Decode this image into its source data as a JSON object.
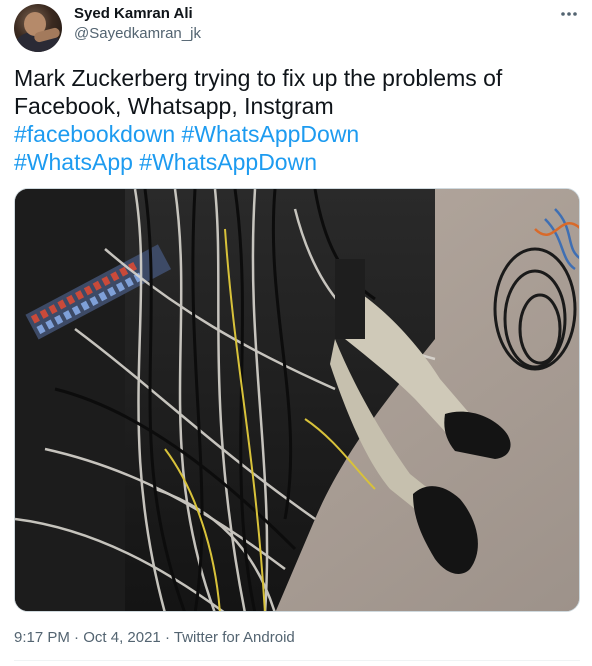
{
  "author": {
    "display_name": "Syed Kamran Ali",
    "handle": "@Sayedkamran_jk"
  },
  "tweet": {
    "text_line1": "Mark Zuckerberg trying to fix up the problems of",
    "text_line2": "Facebook, Whatsapp, Instgram",
    "hashtags_line1": [
      "#facebookdown",
      "#WhatsAppDown"
    ],
    "hashtags_line2": [
      "#WhatsApp",
      "#WhatsAppDown"
    ],
    "time": "9:17 PM",
    "date": "Oct 4, 2021",
    "source": "Twitter for Android",
    "separator": "·"
  },
  "icons": {
    "more": "more-horizontal-icon",
    "avatar": "user-avatar"
  },
  "colors": {
    "hashtag": "#1d9bf0",
    "secondary_text": "#536471",
    "primary_text": "#0f1419"
  }
}
